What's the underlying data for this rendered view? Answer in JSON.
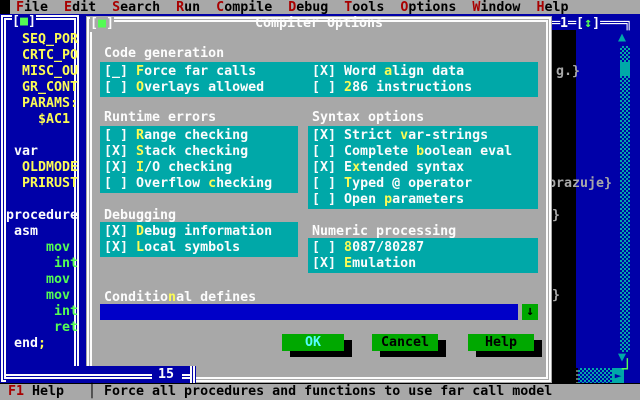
{
  "colors": {
    "menu_gray": "#A8A8A8",
    "desktop_blue": "#0000A8",
    "panel_teal": "#00A8A8",
    "button_green": "#00A800",
    "bright_green": "#54FC54",
    "yellow": "#FCFC54",
    "white": "#FCFCFC",
    "hotkey_red": "#A80000",
    "ok_cyan": "#54FCFC",
    "input_blue": "#0000C8",
    "shadow_black": "#000000",
    "editor_text_gray": "#A8A8A8"
  },
  "menu": {
    "items": [
      {
        "label": "File"
      },
      {
        "label": "Edit"
      },
      {
        "label": "Search"
      },
      {
        "label": "Run"
      },
      {
        "label": "Compile"
      },
      {
        "label": "Debug"
      },
      {
        "label": "Tools"
      },
      {
        "label": "Options"
      },
      {
        "label": "Window"
      },
      {
        "label": "Help"
      }
    ]
  },
  "left_window": {
    "close_glyph": "■",
    "line_indicator": "15",
    "lines": [
      {
        "indent": 2,
        "text": "SEQ_POR",
        "color": "yellow"
      },
      {
        "indent": 2,
        "text": "CRTC_PO",
        "color": "yellow"
      },
      {
        "indent": 2,
        "text": "MISC_OU",
        "color": "yellow"
      },
      {
        "indent": 2,
        "text": "GR_CONT",
        "color": "yellow"
      },
      {
        "indent": 2,
        "text": "PARAMS:",
        "color": "yellow"
      },
      {
        "indent": 4,
        "text": "$AC1",
        "color": "yellow"
      },
      null,
      {
        "indent": 1,
        "text": "var",
        "color": "white"
      },
      {
        "indent": 2,
        "text": "OLDMODE",
        "color": "yellow"
      },
      {
        "indent": 2,
        "text": "PRIRUST",
        "color": "yellow"
      },
      null,
      {
        "indent": 0,
        "text": "procedure",
        "color": "white"
      },
      {
        "indent": 1,
        "text": "asm",
        "color": "white"
      },
      {
        "indent": 5,
        "text": "mov",
        "color": "green"
      },
      {
        "indent": 6,
        "text": "int",
        "color": "green"
      },
      {
        "indent": 5,
        "text": "mov",
        "color": "green"
      },
      {
        "indent": 5,
        "text": "mov",
        "color": "green"
      },
      {
        "indent": 6,
        "text": "int",
        "color": "green"
      },
      {
        "indent": 6,
        "text": "ret",
        "color": "green"
      },
      {
        "indent": 1,
        "text": "end",
        "color": "white",
        "suffix": {
          "text": ";",
          "color": "yellow"
        }
      }
    ]
  },
  "editor_window": {
    "number": "1",
    "zoom_glyph": "↕",
    "top_border_left": "═1═[",
    "top_border_right": "]═══╗",
    "fragments": [
      {
        "text": "g.}"
      },
      {
        "text": "brazuje}"
      },
      {
        "text": "}"
      },
      {
        "text": "}"
      }
    ],
    "scrollbar": {
      "up": "▲",
      "down": "▼",
      "right": "►",
      "corner": "┘"
    }
  },
  "dialog": {
    "title": "Compiler Options",
    "close_glyph": "■",
    "groups": [
      {
        "title": "Code generation",
        "columns": [
          [
            {
              "state": "_",
              "label": "Force far calls",
              "hot": 0
            },
            {
              "state": " ",
              "label": "Overlays allowed",
              "hot": 0
            }
          ],
          [
            {
              "state": "X",
              "label": "Word align data",
              "hot": 5
            },
            {
              "state": " ",
              "label": "286 instructions",
              "hot": 0
            }
          ]
        ]
      },
      {
        "title": "Runtime errors",
        "columns": [
          [
            {
              "state": " ",
              "label": "Range checking",
              "hot": 0
            },
            {
              "state": "X",
              "label": "Stack checking",
              "hot": 0
            },
            {
              "state": "X",
              "label": "I/O checking",
              "hot": 0
            },
            {
              "state": " ",
              "label": "Overflow checking",
              "hot": 9
            }
          ]
        ]
      },
      {
        "title": "Syntax options",
        "columns": [
          [
            {
              "state": "X",
              "label": "Strict var-strings",
              "hot": 7
            },
            {
              "state": " ",
              "label": "Complete boolean eval",
              "hot": 9
            },
            {
              "state": "X",
              "label": "Extended syntax",
              "hot": 1
            },
            {
              "state": " ",
              "label": "Typed @ operator",
              "hot": 0
            },
            {
              "state": " ",
              "label": "Open parameters",
              "hot": 5
            }
          ]
        ]
      },
      {
        "title": "Debugging",
        "columns": [
          [
            {
              "state": "X",
              "label": "Debug information",
              "hot": 0
            },
            {
              "state": "X",
              "label": "Local symbols",
              "hot": 0
            }
          ]
        ]
      },
      {
        "title": "Numeric processing",
        "columns": [
          [
            {
              "state": " ",
              "label": "8087/80287",
              "hot": 0
            },
            {
              "state": "X",
              "label": "Emulation",
              "hot": 0
            }
          ]
        ]
      }
    ],
    "conditional_defines": {
      "label": "Conditional defines",
      "hot": 8,
      "value": "",
      "history_glyph": "↓"
    },
    "buttons": [
      {
        "label": "OK",
        "default": true
      },
      {
        "label": "Cancel",
        "default": false
      },
      {
        "label": "Help",
        "default": false
      }
    ]
  },
  "status_bar": {
    "key": "F1",
    "key_label": "Help",
    "separator": "│",
    "message": "Force all procedures and functions to use far call model"
  }
}
